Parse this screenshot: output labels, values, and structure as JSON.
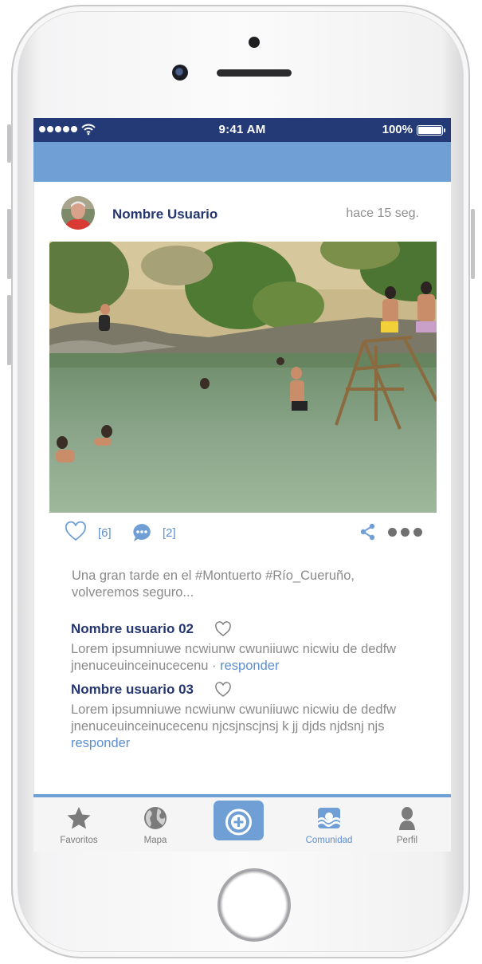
{
  "status_bar": {
    "time": "9:41 AM",
    "battery": "100%"
  },
  "post": {
    "author": "Nombre Usuario",
    "time": "hace 15 seg.",
    "likes": "[6]",
    "comments_count": "[2]",
    "caption": "Una gran tarde en el #Montuerto #Río_Cueruño, volveremos seguro..."
  },
  "comments": [
    {
      "user": "Nombre usuario 02",
      "text": "Lorem ipsumniuwe ncwiunw cwuniiuwc nicwiu de dedfw jnenuceuinceinucecenu · ",
      "reply": "responder"
    },
    {
      "user": "Nombre usuario 03",
      "text": "Lorem ipsumniuwe ncwiunw cwuniiuwc nicwiu de dedfw jnenuceuinceinucecenu njcsjnscjnsj   k  jj  djds njdsnj njs ",
      "reply": "responder"
    }
  ],
  "tabs": [
    {
      "label": "Favoritos",
      "icon": "star-icon"
    },
    {
      "label": "Mapa",
      "icon": "globe-icon"
    },
    {
      "label": "",
      "icon": "camera-plus-icon"
    },
    {
      "label": "Comunidad",
      "icon": "community-waves-icon"
    },
    {
      "label": "Perfil",
      "icon": "user-icon"
    }
  ],
  "colors": {
    "status_bar": "#233a76",
    "accent": "#6f9fd5",
    "name": "#253670",
    "text": "#8a8a8a"
  }
}
